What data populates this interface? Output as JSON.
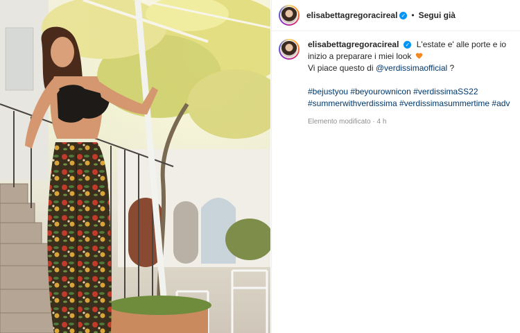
{
  "post": {
    "username": "elisabettagregoracireal",
    "separator": "•",
    "follow_label": "Segui già",
    "caption_line1": "L'estate e' alle porte e io inizio a preparare i miei look",
    "caption_line2_prefix": "Vi piace questo di",
    "caption_mention": "@verdissimaofficial",
    "caption_line2_suffix": "?",
    "hashtags": [
      "#bejustyou",
      "#beyourownicon",
      "#verdissimaSS22",
      "#summerwithverdissima",
      "#verdissimasummertime",
      "#adv"
    ],
    "edited_label": "Elemento modificato",
    "time_ago": "4 h",
    "heart_emoji_color": "#f5891f",
    "link_color": "#00376b",
    "verified_color": "#0095f6"
  }
}
